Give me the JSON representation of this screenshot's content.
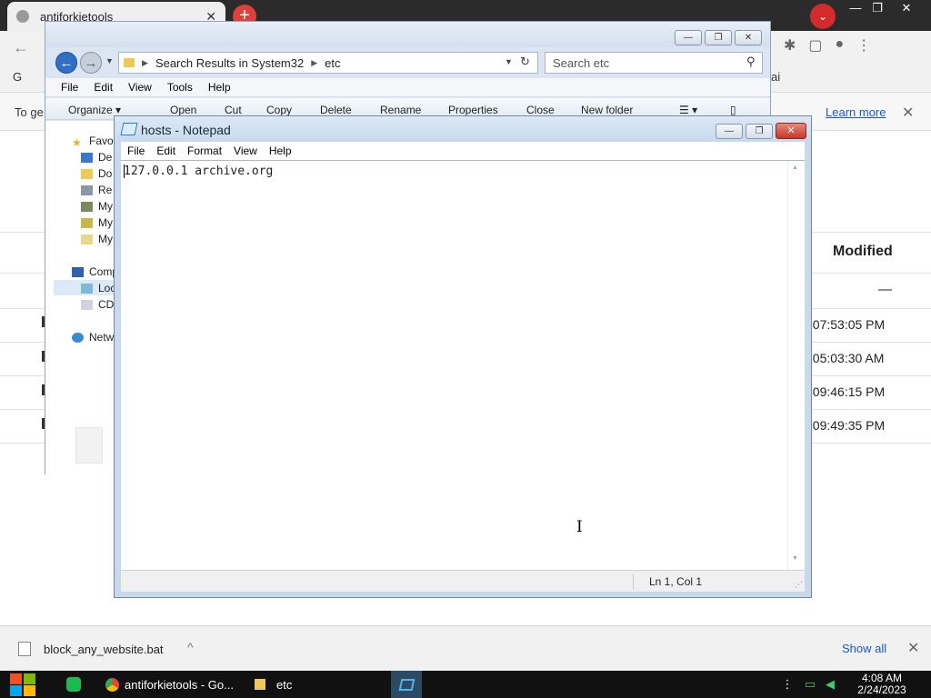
{
  "chrome": {
    "tab_title": "antiforkietools",
    "tab_close": "✕",
    "new_tab": "+",
    "profile_glyph": "⌄",
    "window_controls": [
      "—",
      "❐",
      "✕"
    ],
    "back_glyph": "←",
    "ext_icons": [
      "puzzle-icon",
      "sidepanel-icon",
      "account-icon",
      "menu-icon"
    ],
    "bookmark_left": "G",
    "bookmark_right": "ai",
    "info_text": "To ge",
    "info_learn_more": "Learn more",
    "info_close": "✕",
    "table_header_modified": "Modified",
    "table_dash": "—",
    "rows": [
      {
        "time": ", 07:53:05 PM"
      },
      {
        "time": ", 05:03:30 AM"
      },
      {
        "time": ", 09:46:15 PM"
      },
      {
        "time": ", 09:49:35 PM"
      }
    ]
  },
  "download_shelf": {
    "file_name": "block_any_website.bat",
    "chevron": "^",
    "show_all": "Show all",
    "close": "✕"
  },
  "taskbar": {
    "items": [
      {
        "label": "antiforkietools - Go..."
      },
      {
        "label": "etc"
      }
    ],
    "time": "4:08 AM",
    "date": "2/24/2023"
  },
  "explorer": {
    "address_segments": [
      "Search Results in System32",
      "etc"
    ],
    "search_placeholder": "Search etc",
    "menu": [
      "File",
      "Edit",
      "View",
      "Tools",
      "Help"
    ],
    "commands": [
      "Organize ▾",
      "Open",
      "Cut",
      "Copy",
      "Delete",
      "Rename",
      "Properties",
      "Close",
      "New folder"
    ],
    "tree": [
      "Favo",
      "De",
      "Do",
      "Re",
      "My",
      "My",
      "My",
      "Comp",
      "Loc",
      "CD",
      "Netw"
    ]
  },
  "notepad": {
    "title": "hosts - Notepad",
    "menu": [
      "File",
      "Edit",
      "Format",
      "View",
      "Help"
    ],
    "content": "127.0.0.1 archive.org",
    "status_position": "Ln 1, Col 1",
    "btn_min": "—",
    "btn_max": "❐",
    "btn_close": "✕"
  }
}
